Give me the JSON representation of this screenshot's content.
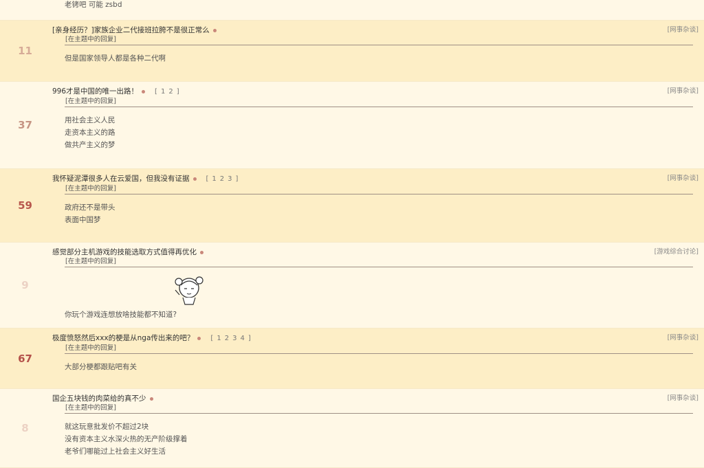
{
  "colors": {
    "count_high": "#b85a50",
    "count_mid": "#c99989",
    "count_low": "#e8c8b8",
    "dot": "#c9877a"
  },
  "first_row_text": "老铐吧 可能 zsbd",
  "topics": [
    {
      "count": "11",
      "count_color": "#d6ab97",
      "title": "[亲身经历？]家族企业二代接班拉胯不是很正常么",
      "pages": [],
      "forum": "[网事杂谈]",
      "reply_tag": "[在主题中的回复]",
      "lines": [
        "但是国家领导人都是各种二代啊"
      ],
      "sticker": false
    },
    {
      "count": "37",
      "count_color": "#c69584",
      "title": "996才是中国的唯一出路！",
      "pages": [
        "[",
        "1",
        "2",
        "]"
      ],
      "forum": "[网事杂谈]",
      "reply_tag": "[在主题中的回复]",
      "lines": [
        "用社会主义人民",
        "走资本主义的路",
        "做共产主义的梦"
      ],
      "sticker": false
    },
    {
      "count": "59",
      "count_color": "#b8584e",
      "title": "我怀疑泥潭很多人在云爱国，但我没有证据",
      "pages": [
        "[",
        "1",
        "2",
        "3",
        "]"
      ],
      "forum": "[网事杂谈]",
      "reply_tag": "[在主题中的回复]",
      "lines": [
        "政府还不是带头",
        "表面中国梦"
      ],
      "sticker": false
    },
    {
      "count": "9",
      "count_color": "#ecd2c4",
      "title": "感觉部分主机游戏的技能选取方式值得再优化",
      "pages": [],
      "forum": "[游戏综合讨论]",
      "reply_tag": "[在主题中的回复]",
      "lines": [
        "你玩个游戏连想放啥技能都不知道?"
      ],
      "sticker": true
    },
    {
      "count": "67",
      "count_color": "#b4514a",
      "title": "极度愤怒然后xxx的梗是从nga传出来的吧？",
      "pages": [
        "[",
        "1",
        "2",
        "3",
        "4",
        "]"
      ],
      "forum": "[网事杂谈]",
      "reply_tag": "[在主题中的回复]",
      "lines": [
        "大部分梗都跟贴吧有关"
      ],
      "sticker": false
    },
    {
      "count": "8",
      "count_color": "#ecd2c4",
      "title": "国企五块钱的肉菜给的真不少",
      "pages": [],
      "forum": "[网事杂谈]",
      "reply_tag": "[在主题中的回复]",
      "lines": [
        "就这玩意批发价不超过2块",
        "没有资本主义水深火热的无产阶级撑着",
        "老爷们哪能过上社会主义好生活"
      ],
      "sticker": false
    }
  ]
}
